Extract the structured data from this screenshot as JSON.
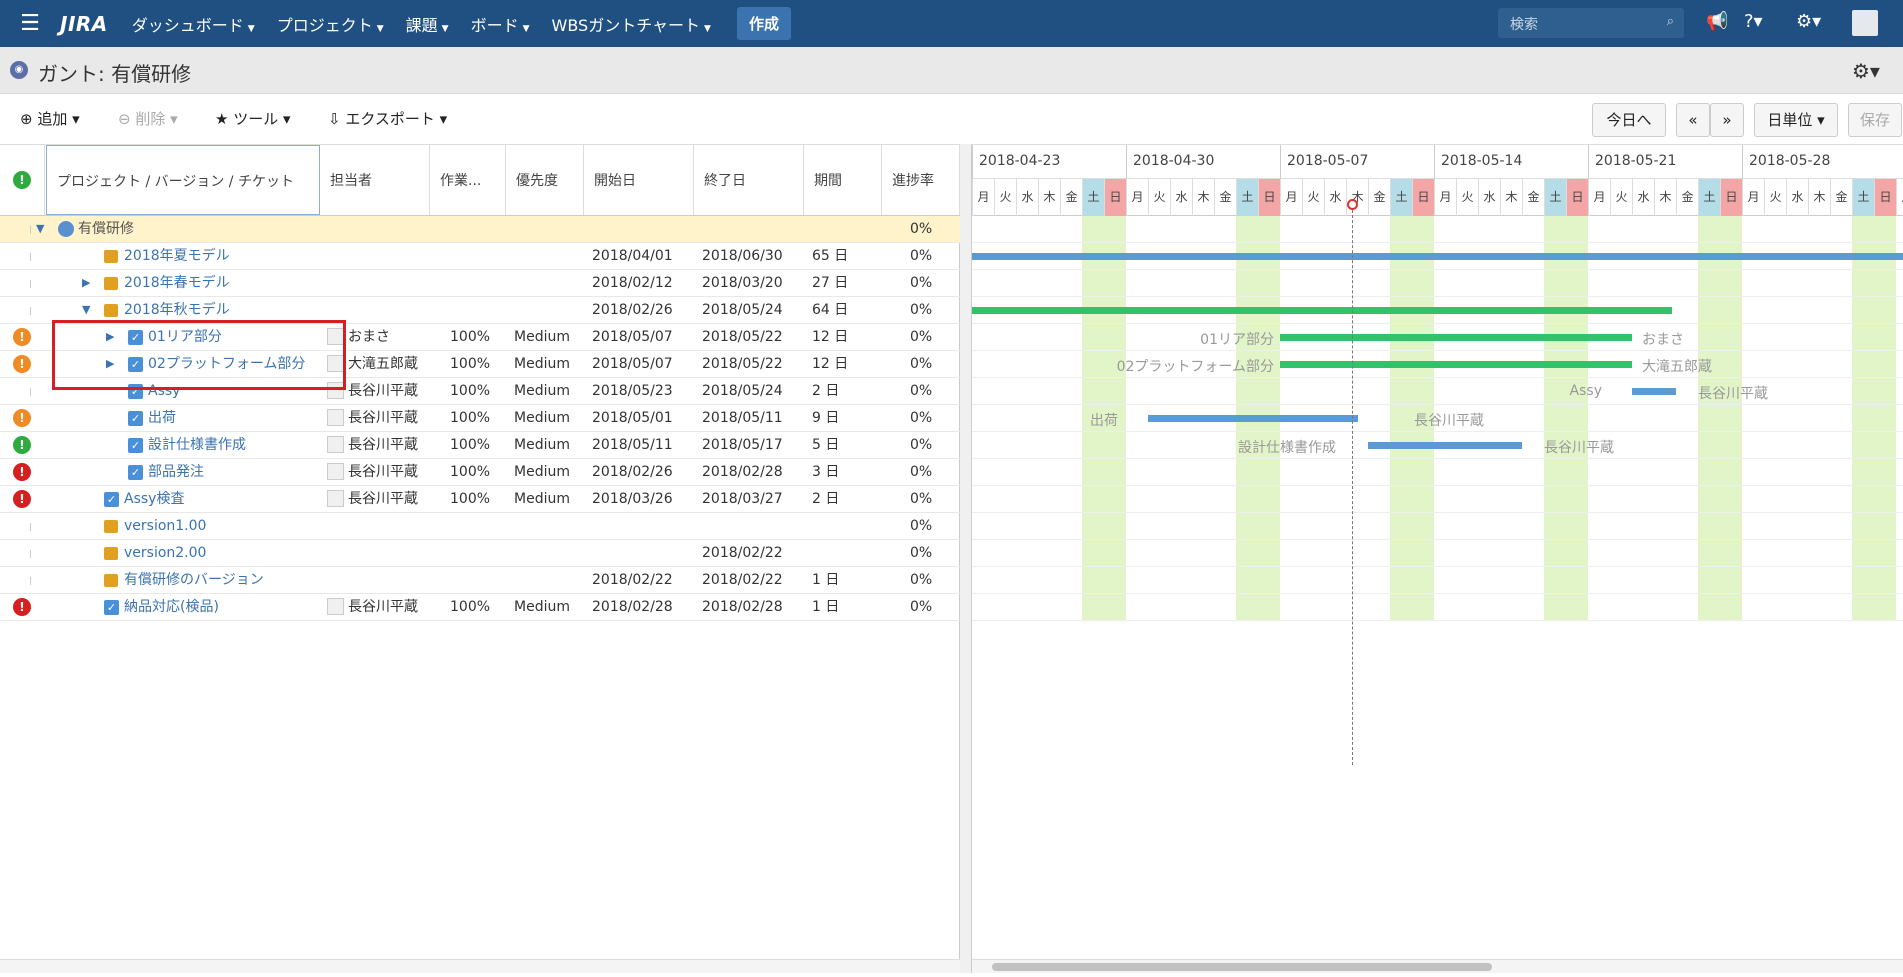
{
  "nav": {
    "logo": "JIRA",
    "items": [
      "ダッシュボード",
      "プロジェクト",
      "課題",
      "ボード",
      "WBSガントチャート"
    ],
    "create": "作成",
    "search_placeholder": "検索"
  },
  "page": {
    "title": "ガント: 有償研修"
  },
  "toolbar": {
    "add": "追加",
    "delete": "削除",
    "tools": "ツール",
    "export": "エクスポート",
    "today": "今日へ",
    "prev": "«",
    "next": "»",
    "unit": "日単位",
    "save": "保存"
  },
  "columns": [
    "プロジェクト / バージョン / チケット",
    "担当者",
    "作業...",
    "優先度",
    "開始日",
    "終了日",
    "期間",
    "進捗率"
  ],
  "rows": [
    {
      "name": "有償研修",
      "assignee": "",
      "work": "",
      "priority": "",
      "start": "",
      "end": "",
      "dur": "",
      "progress": "0%"
    },
    {
      "name": "2018年夏モデル",
      "assignee": "",
      "work": "",
      "priority": "",
      "start": "2018/04/01",
      "end": "2018/06/30",
      "dur": "65 日",
      "progress": "0%"
    },
    {
      "name": "2018年春モデル",
      "assignee": "",
      "work": "",
      "priority": "",
      "start": "2018/02/12",
      "end": "2018/03/20",
      "dur": "27 日",
      "progress": "0%"
    },
    {
      "name": "2018年秋モデル",
      "assignee": "",
      "work": "",
      "priority": "",
      "start": "2018/02/26",
      "end": "2018/05/24",
      "dur": "64 日",
      "progress": "0%"
    },
    {
      "name": "01リア部分",
      "assignee": "おまさ",
      "work": "100%",
      "priority": "Medium",
      "start": "2018/05/07",
      "end": "2018/05/22",
      "dur": "12 日",
      "progress": "0%"
    },
    {
      "name": "02プラットフォーム部分",
      "assignee": "大滝五郎蔵",
      "work": "100%",
      "priority": "Medium",
      "start": "2018/05/07",
      "end": "2018/05/22",
      "dur": "12 日",
      "progress": "0%"
    },
    {
      "name": "Assy",
      "assignee": "長谷川平蔵",
      "work": "100%",
      "priority": "Medium",
      "start": "2018/05/23",
      "end": "2018/05/24",
      "dur": "2 日",
      "progress": "0%"
    },
    {
      "name": "出荷",
      "assignee": "長谷川平蔵",
      "work": "100%",
      "priority": "Medium",
      "start": "2018/05/01",
      "end": "2018/05/11",
      "dur": "9 日",
      "progress": "0%"
    },
    {
      "name": "設計仕様書作成",
      "assignee": "長谷川平蔵",
      "work": "100%",
      "priority": "Medium",
      "start": "2018/05/11",
      "end": "2018/05/17",
      "dur": "5 日",
      "progress": "0%"
    },
    {
      "name": "部品発注",
      "assignee": "長谷川平蔵",
      "work": "100%",
      "priority": "Medium",
      "start": "2018/02/26",
      "end": "2018/02/28",
      "dur": "3 日",
      "progress": "0%"
    },
    {
      "name": "Assy検査",
      "assignee": "長谷川平蔵",
      "work": "100%",
      "priority": "Medium",
      "start": "2018/03/26",
      "end": "2018/03/27",
      "dur": "2 日",
      "progress": "0%"
    },
    {
      "name": "version1.00",
      "assignee": "",
      "work": "",
      "priority": "",
      "start": "",
      "end": "",
      "dur": "",
      "progress": "0%"
    },
    {
      "name": "version2.00",
      "assignee": "",
      "work": "",
      "priority": "",
      "start": "",
      "end": "2018/02/22",
      "dur": "",
      "progress": "0%"
    },
    {
      "name": "有償研修のバージョン",
      "assignee": "",
      "work": "",
      "priority": "",
      "start": "2018/02/22",
      "end": "2018/02/22",
      "dur": "1 日",
      "progress": "0%"
    },
    {
      "name": "納品対応(検品)",
      "assignee": "長谷川平蔵",
      "work": "100%",
      "priority": "Medium",
      "start": "2018/02/28",
      "end": "2018/02/28",
      "dur": "1 日",
      "progress": "0%"
    }
  ],
  "gantt": {
    "weeks": [
      "2018-04-23",
      "2018-04-30",
      "2018-05-07",
      "2018-05-14",
      "2018-05-21",
      "2018-05-28"
    ],
    "days": [
      "月",
      "火",
      "水",
      "木",
      "金",
      "土",
      "日"
    ],
    "labels": {
      "l1": "01リア部分",
      "r1": "おまさ",
      "l2": "02プラットフォーム部分",
      "r2": "大滝五郎蔵",
      "l3": "Assy",
      "r3": "長谷川平蔵",
      "l4": "出荷",
      "r4": "長谷川平蔵",
      "l5": "設計仕様書作成",
      "r5": "長谷川平蔵"
    }
  },
  "colors": {
    "nav": "#205081",
    "version_bar": "#5b9bd5",
    "task_bar": "#33c26a",
    "weekend_band": "#e2f5c8"
  }
}
